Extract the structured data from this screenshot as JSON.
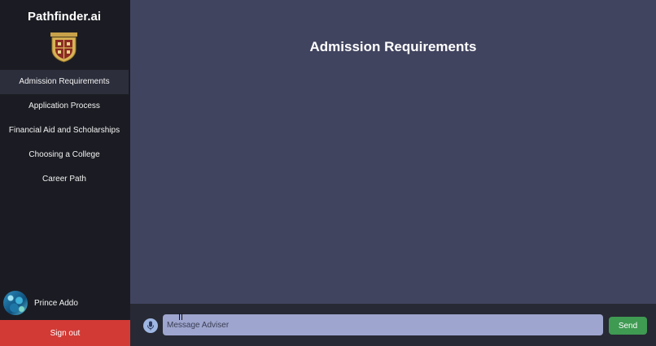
{
  "sidebar": {
    "brand": "Pathfinder.ai",
    "logo_icon": "college-crest-icon",
    "items": [
      {
        "label": "Admission Requirements",
        "active": true
      },
      {
        "label": "Application Process",
        "active": false
      },
      {
        "label": "Financial Aid and Scholarships",
        "active": false
      },
      {
        "label": "Choosing a College",
        "active": false
      },
      {
        "label": "Career Path",
        "active": false
      }
    ],
    "user": {
      "name": "Prince Addo"
    },
    "signout_label": "Sign out"
  },
  "main": {
    "title": "Admission Requirements"
  },
  "composer": {
    "placeholder": "Message Adviser",
    "send_label": "Send",
    "mic_icon": "microphone-icon"
  },
  "colors": {
    "sidebar_bg": "#1b1c23",
    "main_bg": "#41445f",
    "signout_bg": "#d23a35",
    "send_bg": "#3f9a52",
    "input_bg": "#9ea6cf"
  }
}
